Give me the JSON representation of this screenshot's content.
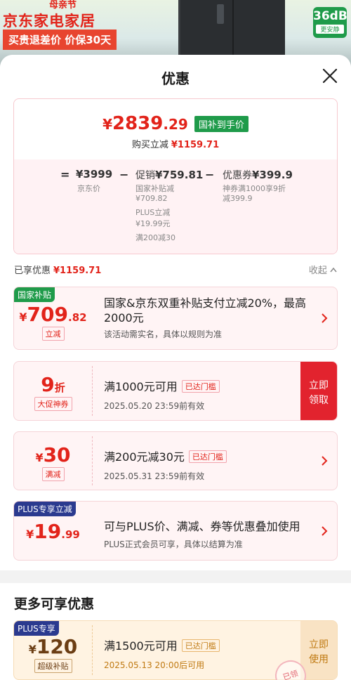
{
  "banner": {
    "festival": "母亲节",
    "store": "京东家电家居",
    "promo": "买贵退差价 价保30天",
    "db_value": "36dB",
    "db_sub": "更安静"
  },
  "sheet": {
    "title": "优惠"
  },
  "price": {
    "final_int": "2839",
    "final_dec": ".29",
    "yen": "¥",
    "subsidy_tag": "国补到手价",
    "reduce_label": "购买立减",
    "reduce_amount": "¥1159.71"
  },
  "calc": {
    "eq": "=",
    "base_val": "¥3999",
    "base_sub": "京东价",
    "minus": "−",
    "promo_label": "促销",
    "promo_val": "¥759.81",
    "promo_sub1": "国家补贴减",
    "promo_sub2": "¥709.82",
    "promo_sub3": "PLUS立减",
    "promo_sub4": "¥19.99元",
    "promo_sub5": "满200减30",
    "coupon_label": "优惠券",
    "coupon_val": "¥399.9",
    "coupon_sub1": "神券满1000享9折",
    "coupon_sub2": "减399.9"
  },
  "enjoyed": {
    "label": "已享优惠",
    "amount": "¥1159.71",
    "collapse": "收起"
  },
  "offers": [
    {
      "corner": "国家补贴",
      "yen": "¥",
      "int": "709",
      "dec": ".82",
      "box": "立减",
      "main": "国家&京东双重补贴支付立减20%，最高2000元",
      "sub": "该活动需实名，具体以规则为准"
    },
    {
      "int": "9",
      "unit": "折",
      "box": "大促神券",
      "main": "满1000元可用",
      "reached": "已达门槛",
      "sub": "2025.05.20 23:59前有效",
      "claim": "立即领取"
    },
    {
      "yen": "¥",
      "int": "30",
      "box": "满减",
      "main": "满200元减30元",
      "reached": "已达门槛",
      "sub": "2025.05.31 23:59前有效"
    },
    {
      "corner": "PLUS专享立减",
      "yen": "¥",
      "int": "19",
      "dec": ".99",
      "main": "可与PLUS价、满减、券等优惠叠加使用",
      "sub": "PLUS正式会员可享，具体以结算为准"
    }
  ],
  "more": {
    "title": "更多可享优惠",
    "corner": "PLUS专享",
    "yen": "¥",
    "int": "120",
    "box": "超级补贴",
    "main": "满1500元可用",
    "reached": "已达门槛",
    "sub": "2025.05.13 20:00后可用",
    "claim": "立即使用",
    "stamp": "已领"
  },
  "colors": {
    "accent": "#e2231a",
    "subsidy_green": "#1f9b4a",
    "plus_blue": "#2b3a8f"
  },
  "icons": {
    "close": "close-icon",
    "arrow": "chevron-right-icon",
    "collapse": "chevron-up-icon"
  }
}
